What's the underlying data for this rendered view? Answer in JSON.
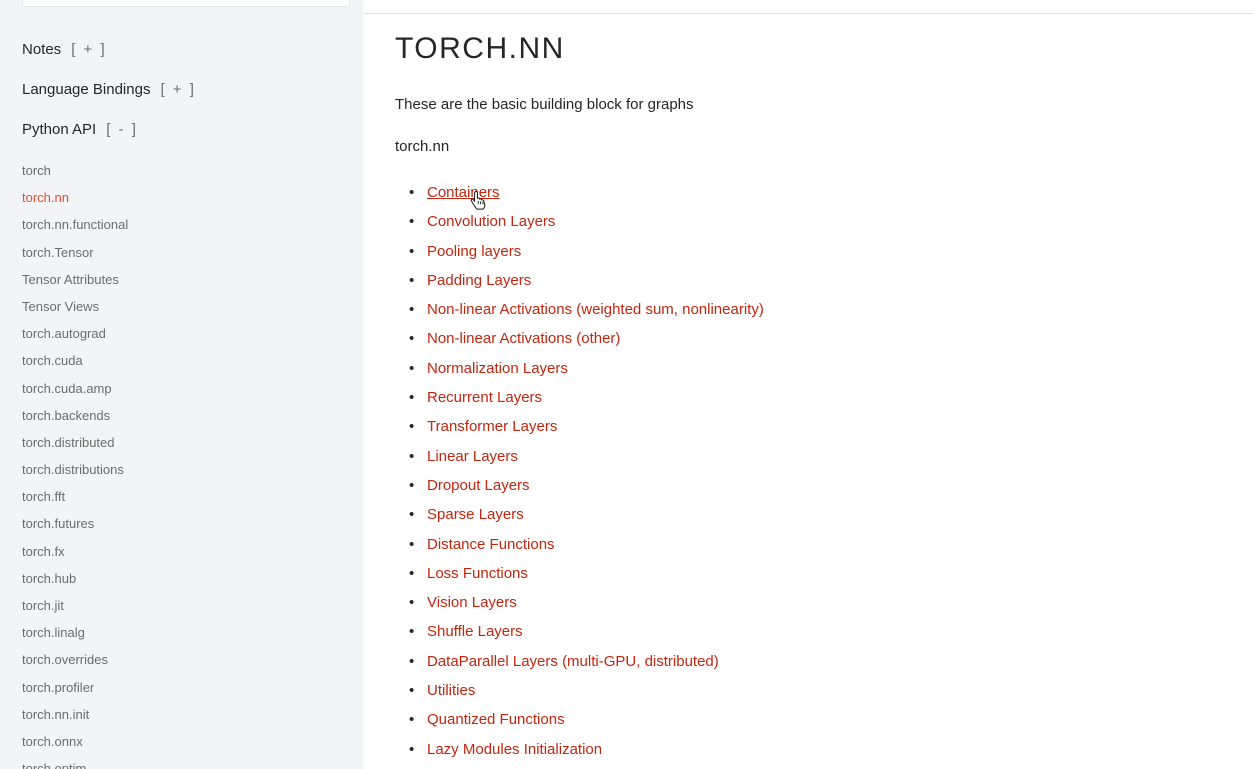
{
  "sidebar": {
    "sections": [
      {
        "label": "Notes",
        "toggle": "[ + ]"
      },
      {
        "label": "Language Bindings",
        "toggle": "[ + ]"
      },
      {
        "label": "Python API",
        "toggle": "[ - ]"
      }
    ],
    "items": [
      {
        "label": "torch"
      },
      {
        "label": "torch.nn",
        "active": true
      },
      {
        "label": "torch.nn.functional"
      },
      {
        "label": "torch.Tensor"
      },
      {
        "label": "Tensor Attributes"
      },
      {
        "label": "Tensor Views"
      },
      {
        "label": "torch.autograd"
      },
      {
        "label": "torch.cuda"
      },
      {
        "label": "torch.cuda.amp"
      },
      {
        "label": "torch.backends"
      },
      {
        "label": "torch.distributed"
      },
      {
        "label": "torch.distributions"
      },
      {
        "label": "torch.fft"
      },
      {
        "label": "torch.futures"
      },
      {
        "label": "torch.fx"
      },
      {
        "label": "torch.hub"
      },
      {
        "label": "torch.jit"
      },
      {
        "label": "torch.linalg"
      },
      {
        "label": "torch.overrides"
      },
      {
        "label": "torch.profiler"
      },
      {
        "label": "torch.nn.init"
      },
      {
        "label": "torch.onnx"
      },
      {
        "label": "torch.optim"
      }
    ]
  },
  "main": {
    "title": "TORCH.NN",
    "intro": "These are the basic building block for graphs",
    "module_name": "torch.nn",
    "bullet": "•",
    "links": [
      {
        "label": "Containers",
        "hovered": true
      },
      {
        "label": "Convolution Layers"
      },
      {
        "label": "Pooling layers"
      },
      {
        "label": "Padding Layers"
      },
      {
        "label": "Non-linear Activations (weighted sum, nonlinearity)"
      },
      {
        "label": "Non-linear Activations (other)"
      },
      {
        "label": "Normalization Layers"
      },
      {
        "label": "Recurrent Layers"
      },
      {
        "label": "Transformer Layers"
      },
      {
        "label": "Linear Layers"
      },
      {
        "label": "Dropout Layers"
      },
      {
        "label": "Sparse Layers"
      },
      {
        "label": "Distance Functions"
      },
      {
        "label": "Loss Functions"
      },
      {
        "label": "Vision Layers"
      },
      {
        "label": "Shuffle Layers"
      },
      {
        "label": "DataParallel Layers (multi-GPU, distributed)"
      },
      {
        "label": "Utilities"
      },
      {
        "label": "Quantized Functions"
      },
      {
        "label": "Lazy Modules Initialization"
      }
    ]
  },
  "colors": {
    "link": "#c1260e",
    "active_nav": "#e44c2c",
    "sidebar_bg": "#f3f4f7"
  },
  "cursor": {
    "icon": "hand-pointer-icon"
  }
}
